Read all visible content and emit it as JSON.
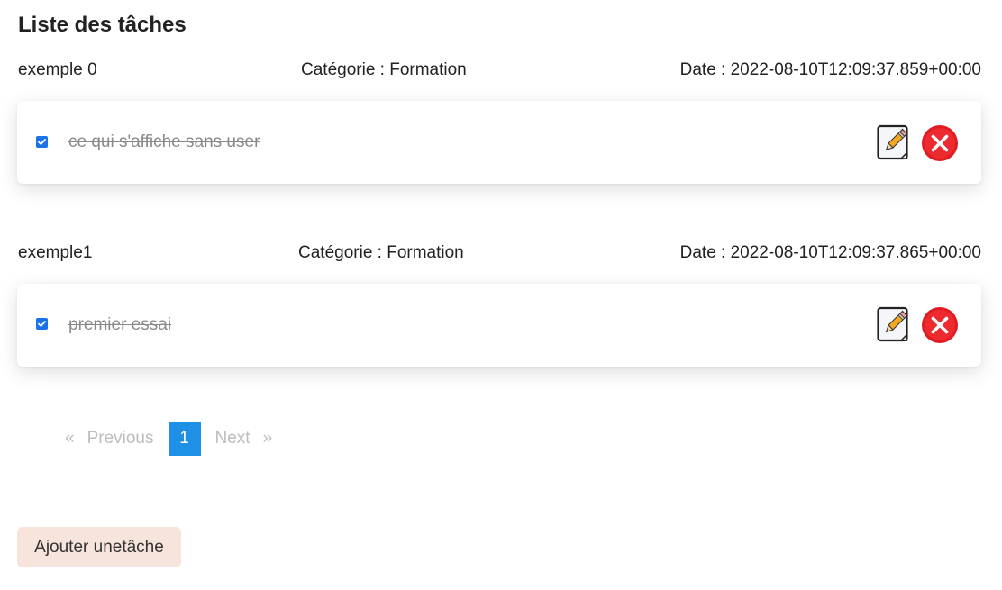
{
  "header": {
    "title": "Liste des tâches"
  },
  "tasks": [
    {
      "name": "exemple 0",
      "category": "Catégorie : Formation",
      "date": "Date : 2022-08-10T12:09:37.859+00:00",
      "text": "ce qui s'affiche sans user",
      "checked": true
    },
    {
      "name": "exemple1",
      "category": "Catégorie : Formation",
      "date": "Date : 2022-08-10T12:09:37.865+00:00",
      "text": "premier essai",
      "checked": true
    }
  ],
  "icons": {
    "edit": "edit-pencil-icon",
    "delete": "close-x-icon"
  },
  "pagination": {
    "prev_arrow": "«",
    "previous": "Previous",
    "current_page": "1",
    "next": "Next",
    "next_arrow": "»"
  },
  "actions": {
    "add_label": "Ajouter unetâche"
  },
  "colors": {
    "accent": "#1e90e6",
    "delete_red": "#e01b22",
    "add_button_bg": "#f7e4dc",
    "checkbox": "#1a73e8"
  }
}
